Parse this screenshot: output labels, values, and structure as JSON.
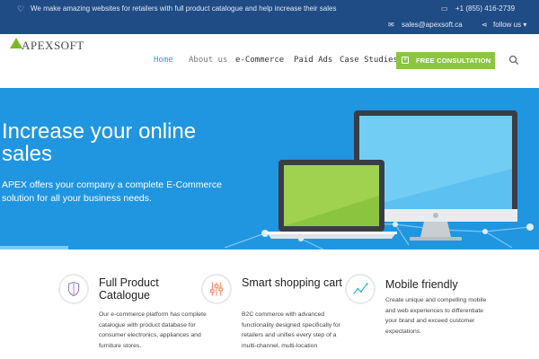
{
  "topbar": {
    "heart_icon": "heart-icon",
    "tagline": "We make amazing websites for retailers with full product catalogue and help increase their sales",
    "phone": "+1 (855) 416-2739",
    "email": "sales@apexsoft.ca",
    "follow": "follow us ▾"
  },
  "logo": {
    "text": "APEXSOFT"
  },
  "nav": {
    "items": [
      "Home",
      "About us",
      "e-Commerce",
      "Paid Ads",
      "Case Studies"
    ],
    "active": "Home",
    "cta": "FREE CONSULTATION"
  },
  "hero": {
    "title": "Increase your online sales",
    "subtitle": "APEX offers your company a complete E-Commerce solution for all your business needs."
  },
  "features": [
    {
      "icon": "shield-icon",
      "title": "Full Product Catalogue",
      "description": "Our e-commerce platform has complete catalogue with product database for consumer electronics, appliances and furniture stores."
    },
    {
      "icon": "sliders-icon",
      "title": "Smart shopping cart",
      "description": "B2C commerce with advanced functionality designed specifically for retailers and unifies every step of a multi-channel, multi-location"
    },
    {
      "icon": "chart-line-icon",
      "title": "Mobile friendly",
      "description": "Create unique and compelling mobile and web experiences to differentiate your brand and exceed customer expectations."
    }
  ],
  "colors": {
    "topbar": "#1f4c85",
    "hero": "#2196e0",
    "accent_green": "#8cc63f",
    "nav_active": "#2c9fd9"
  }
}
